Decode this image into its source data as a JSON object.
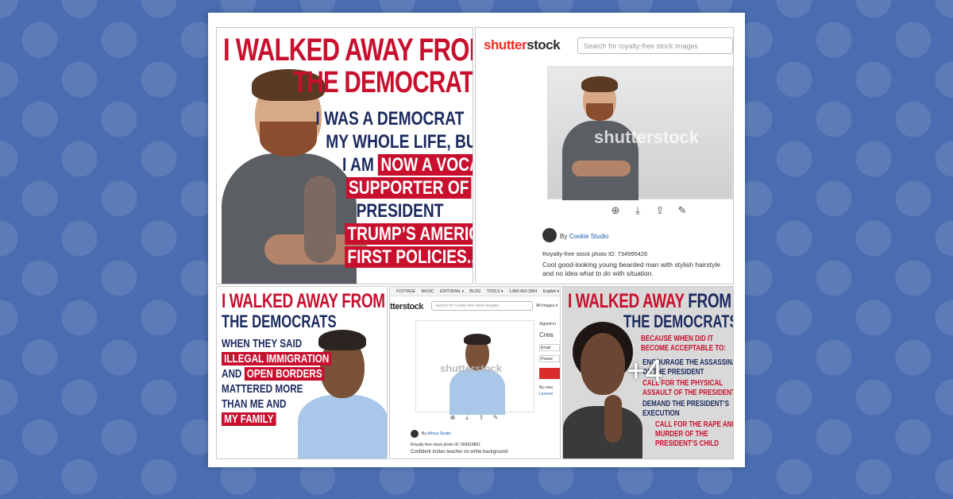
{
  "meme1": {
    "headline_1": "I WALKED AWAY FROM",
    "headline_2": "THE DEMOCRATS",
    "lines": [
      "I WAS A DEMOCRAT",
      "MY WHOLE LIFE, BUT",
      "I AM",
      "NOW A VOCAL",
      "SUPPORTER OF",
      "PRESIDENT",
      "TRUMP’S AMERICA",
      "FIRST POLICIES..."
    ]
  },
  "stock1": {
    "logo_red": "shutter",
    "logo_dark": "stock",
    "search_placeholder": "Search for royalty-free stock images",
    "watermark": "shutterstock",
    "by": "By",
    "author": "Cookie Studio",
    "photo_id": "Royalty-free stock photo ID: 734995426",
    "description": "Cool good-looking young bearded man with stylish hairstyle and no idea what to do with situation."
  },
  "meme2": {
    "headline_1": "I WALKED AWAY FROM",
    "headline_2": "THE DEMOCRATS",
    "lines": [
      "WHEN THEY SAID",
      "ILLEGAL IMMIGRATION",
      "AND",
      "OPEN BORDERS",
      "MATTERED MORE",
      "THAN ME AND",
      "MY FAMILY"
    ]
  },
  "stock2": {
    "nav": [
      "FOOTAGE",
      "MUSIC",
      "EDITORIAL ▾",
      "BLOG",
      "TOOLS ▾",
      "1-866-663-3954",
      "English ▾"
    ],
    "logo": "tterstock",
    "search_placeholder": "Search for royalty-free stock images",
    "all_images": "All Images ▾",
    "watermark": "shutterstock",
    "side": [
      "Signed in",
      "Crea",
      "Email",
      "Passw",
      "By crea",
      "License"
    ],
    "by": "By",
    "author": "Athrus Studio",
    "photo_id": "Royalty-free stock photo ID: 566818861",
    "description": "Confident Indian teacher on white background"
  },
  "meme3": {
    "headline_1": "I WALKED AWAY",
    "headline_1b": "FROM",
    "headline_2": "THE DEMOCRATS",
    "intro": [
      "BECAUSE WHEN DID IT",
      "BECOME ACCEPTABLE TO:"
    ],
    "q1": [
      "ENCOURAGE THE ASSASSINATION",
      "OF THE PRESIDENT"
    ],
    "q2": [
      "CALL FOR THE PHYSICAL",
      "ASSAULT OF THE PRESIDENT"
    ],
    "q3": [
      "DEMAND THE PRESIDENT’S",
      "EXECUTION"
    ],
    "q4": [
      "CALL FOR THE RAPE AND",
      "MURDER OF THE",
      "PRESIDENT’S CHILD"
    ],
    "more_count": "+4"
  },
  "colors": {
    "background": "#4a6cb0",
    "red": "#c8102e",
    "navy": "#1b2a5e",
    "shutterstock_red": "#ee2b24"
  },
  "icons": [
    "plus-icon",
    "download-icon",
    "share-icon",
    "edit-icon"
  ]
}
